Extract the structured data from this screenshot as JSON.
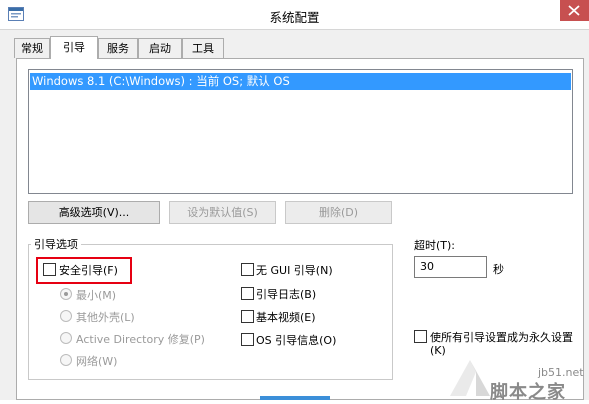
{
  "window": {
    "title": "系统配置"
  },
  "tabs": [
    {
      "label": "常规",
      "active": false
    },
    {
      "label": "引导",
      "active": true
    },
    {
      "label": "服务",
      "active": false
    },
    {
      "label": "启动",
      "active": false
    },
    {
      "label": "工具",
      "active": false
    }
  ],
  "boot_list": {
    "entries": [
      "Windows 8.1 (C:\\Windows) : 当前 OS; 默认 OS"
    ]
  },
  "buttons": {
    "advanced": "高级选项(V)...",
    "set_default": "设为默认值(S)",
    "delete": "删除(D)"
  },
  "boot_options": {
    "group_label": "引导选项",
    "safe_boot": {
      "label": "安全引导(F)",
      "checked": false
    },
    "radios": [
      {
        "label": "最小(M)",
        "selected": true
      },
      {
        "label": "其他外壳(L)",
        "selected": false
      },
      {
        "label": "Active Directory 修复(P)",
        "selected": false
      },
      {
        "label": "网络(W)",
        "selected": false
      }
    ],
    "right_checkboxes": [
      {
        "label": "无 GUI 引导(N)",
        "checked": false
      },
      {
        "label": "引导日志(B)",
        "checked": false
      },
      {
        "label": "基本视频(E)",
        "checked": false
      },
      {
        "label": "OS 引导信息(O)",
        "checked": false
      }
    ]
  },
  "timeout": {
    "label": "超时(T):",
    "value": "30",
    "unit": "秒"
  },
  "permanent": {
    "line1": "使所有引导设置成为永久设置",
    "line2": "(K)",
    "checked": false
  },
  "watermark": {
    "url": "jb51.net",
    "text": "脚本之家"
  },
  "colors": {
    "selection": "#3399ff",
    "close": "#c75050",
    "highlight": "#e60012"
  }
}
